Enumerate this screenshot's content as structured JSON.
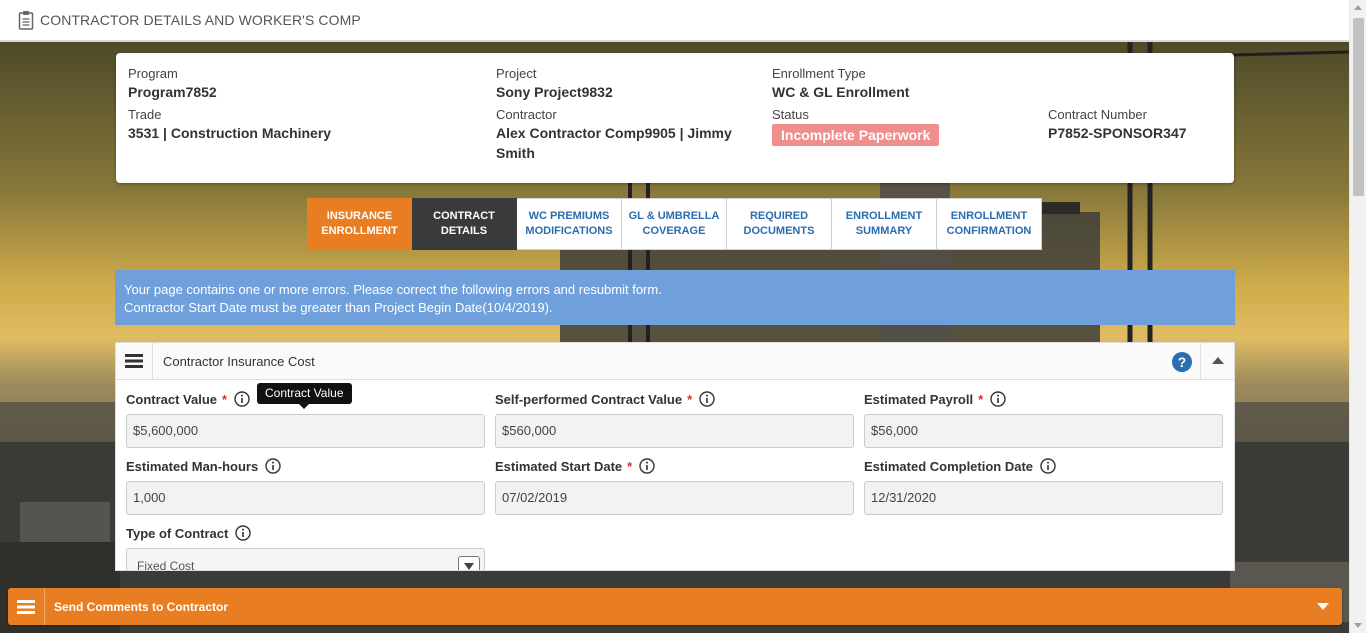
{
  "header": {
    "title": "CONTRACTOR DETAILS AND WORKER'S COMP",
    "icon": "clipboard-icon"
  },
  "info": {
    "program_label": "Program",
    "program_value": "Program7852",
    "project_label": "Project",
    "project_value": "Sony Project9832",
    "enrollment_type_label": "Enrollment Type",
    "enrollment_type_value": "WC & GL Enrollment",
    "trade_label": "Trade",
    "trade_value": "3531 | Construction Machinery",
    "contractor_label": "Contractor",
    "contractor_value_line1": "Alex Contractor Comp9905 | Jimmy",
    "contractor_value_line2": "Smith",
    "status_label": "Status",
    "status_value": "Incomplete Paperwork",
    "contract_number_label": "Contract Number",
    "contract_number_value": "P7852-SPONSOR347"
  },
  "tabs": [
    {
      "line1": "INSURANCE",
      "line2": "ENROLLMENT",
      "state": "done"
    },
    {
      "line1": "CONTRACT",
      "line2": "DETAILS",
      "state": "active"
    },
    {
      "line1": "WC PREMIUMS",
      "line2": "MODIFICATIONS",
      "state": "default"
    },
    {
      "line1": "GL & UMBRELLA",
      "line2": "COVERAGE",
      "state": "default"
    },
    {
      "line1": "REQUIRED",
      "line2": "DOCUMENTS",
      "state": "default"
    },
    {
      "line1": "ENROLLMENT",
      "line2": "SUMMARY",
      "state": "default"
    },
    {
      "line1": "ENROLLMENT",
      "line2": "CONFIRMATION",
      "state": "default"
    }
  ],
  "error": {
    "line1": "Your page contains one or more errors. Please correct the following errors and resubmit form.",
    "line2": "Contractor Start Date must be greater than Project Begin Date(10/4/2019)."
  },
  "panel": {
    "title": "Contractor Insurance Cost",
    "tooltip": "Contract Value",
    "fields": {
      "contract_value": {
        "label": "Contract Value",
        "value": "$5,600,000"
      },
      "self_performed": {
        "label": "Self-performed Contract Value",
        "value": "$560,000"
      },
      "estimated_payroll": {
        "label": "Estimated Payroll",
        "value": "$56,000"
      },
      "man_hours": {
        "label": "Estimated Man-hours",
        "value": "1,000"
      },
      "start_date": {
        "label": "Estimated Start Date",
        "value": "07/02/2019"
      },
      "completion_date": {
        "label": "Estimated Completion Date",
        "value": "12/31/2020"
      },
      "contract_type": {
        "label": "Type of Contract",
        "value": "Fixed Cost"
      }
    },
    "required_mark": "*"
  },
  "comments_bar": {
    "title": "Send Comments to Contractor"
  },
  "colors": {
    "accent_orange": "#e97d22",
    "active_tab": "#3a3a3a",
    "error_blue": "#6fa0db",
    "status_badge": "#f08d8d",
    "link_blue": "#2a6db0"
  }
}
